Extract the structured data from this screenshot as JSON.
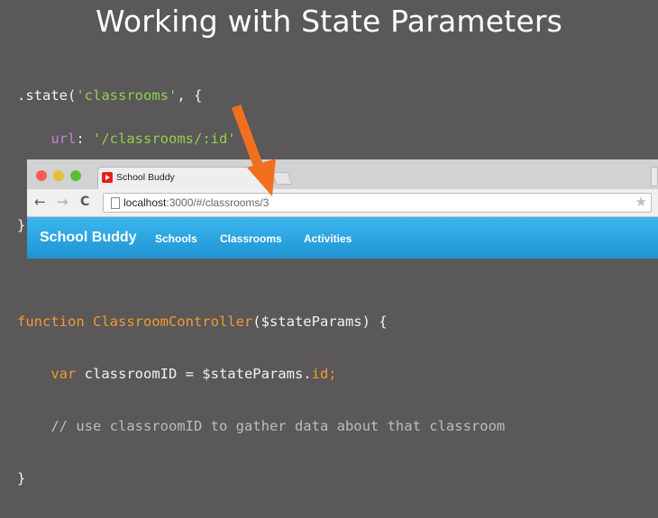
{
  "title": "Working with State Parameters",
  "code_top": {
    "l1_a": ".state(",
    "l1_b": "'classrooms'",
    "l1_c": ", {",
    "l2_indent": "    ",
    "l2_key": "url",
    "l2_colon": ": ",
    "l2_val": "'/classrooms/:id'",
    "l3": "    // ...",
    "l4": "})"
  },
  "browser": {
    "tab_title": "School Buddy",
    "tab_close": "×",
    "back": "←",
    "forward": "→",
    "reload": "C",
    "url_host": "localhost",
    "url_rest": ":3000/#/classrooms/3",
    "star": "★",
    "brand": "School Buddy",
    "nav": [
      "Schools",
      "Classrooms",
      "Activities"
    ]
  },
  "code_bottom": {
    "b1_kw": "function",
    "b1_name": " ClassroomController",
    "b1_rest": "($stateParams) {",
    "b2_indent": "    ",
    "b2_kw": "var",
    "b2_mid": " classroomID = $stateParams.",
    "b2_prop": "id;",
    "b3": "    // use classroomID to gather data about that classroom",
    "b4": "}"
  },
  "colors": {
    "background": "#5a5858",
    "string": "#8fd14f",
    "property": "#c77de0",
    "keyword": "#f39a2e",
    "arrow": "#f07020",
    "nav_bar": "#2aa3e0"
  }
}
